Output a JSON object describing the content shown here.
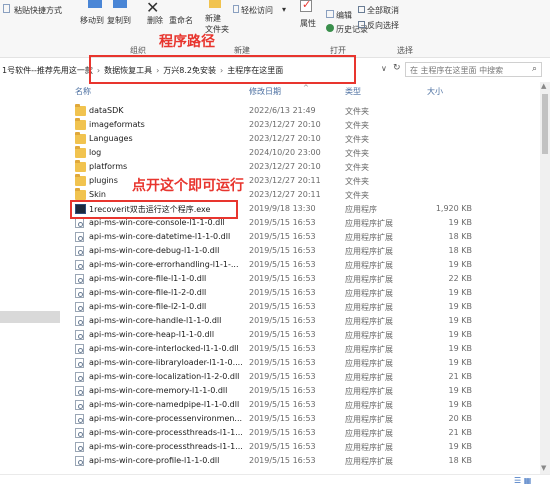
{
  "ribbon": {
    "paste_shortcut": "粘贴快捷方式",
    "move_to": "移动到",
    "copy_to": "复制到",
    "delete": "删除",
    "rename": "重命名",
    "new_folder": "新建\n文件夹",
    "easy_access": "轻松访问",
    "properties": "属性",
    "edit": "编辑",
    "history": "历史记录",
    "select_all": "全部取消",
    "invert_select": "反向选择",
    "group_organize": "组织",
    "group_new": "新建",
    "group_open": "打开",
    "group_select": "选择"
  },
  "address": {
    "crumbs": [
      "1号软件--推荐先用这一款",
      "数据恢复工具",
      "万兴8.2免安装",
      "主程序在这里面"
    ],
    "search_placeholder": "在 主程序在这里面 中搜索"
  },
  "columns": {
    "name": "名称",
    "date": "修改日期",
    "type": "类型",
    "size": "大小"
  },
  "annotations": {
    "path_label": "程序路径",
    "run_label": "点开这个即可运行"
  },
  "files": [
    {
      "name": "dataSDK",
      "date": "2022/6/13 21:49",
      "type": "文件夹",
      "size": "",
      "icon": "folder-icon"
    },
    {
      "name": "imageformats",
      "date": "2023/12/27 20:10",
      "type": "文件夹",
      "size": "",
      "icon": "folder-icon"
    },
    {
      "name": "Languages",
      "date": "2023/12/27 20:10",
      "type": "文件夹",
      "size": "",
      "icon": "folder-icon"
    },
    {
      "name": "log",
      "date": "2024/10/20 23:00",
      "type": "文件夹",
      "size": "",
      "icon": "folder-icon"
    },
    {
      "name": "platforms",
      "date": "2023/12/27 20:10",
      "type": "文件夹",
      "size": "",
      "icon": "folder-icon"
    },
    {
      "name": "plugins",
      "date": "2023/12/27 20:11",
      "type": "文件夹",
      "size": "",
      "icon": "folder-icon"
    },
    {
      "name": "Skin",
      "date": "2023/12/27 20:11",
      "type": "文件夹",
      "size": "",
      "icon": "folder-icon"
    },
    {
      "name": "1recoverit双击运行这个程序.exe",
      "date": "2019/9/18 13:30",
      "type": "应用程序",
      "size": "1,920 KB",
      "icon": "exe-icon"
    },
    {
      "name": "api-ms-win-core-console-l1-1-0.dll",
      "date": "2019/5/15 16:53",
      "type": "应用程序扩展",
      "size": "19 KB",
      "icon": "dll-icon"
    },
    {
      "name": "api-ms-win-core-datetime-l1-1-0.dll",
      "date": "2019/5/15 16:53",
      "type": "应用程序扩展",
      "size": "18 KB",
      "icon": "dll-icon"
    },
    {
      "name": "api-ms-win-core-debug-l1-1-0.dll",
      "date": "2019/5/15 16:53",
      "type": "应用程序扩展",
      "size": "18 KB",
      "icon": "dll-icon"
    },
    {
      "name": "api-ms-win-core-errorhandling-l1-1-...",
      "date": "2019/5/15 16:53",
      "type": "应用程序扩展",
      "size": "19 KB",
      "icon": "dll-icon"
    },
    {
      "name": "api-ms-win-core-file-l1-1-0.dll",
      "date": "2019/5/15 16:53",
      "type": "应用程序扩展",
      "size": "22 KB",
      "icon": "dll-icon"
    },
    {
      "name": "api-ms-win-core-file-l1-2-0.dll",
      "date": "2019/5/15 16:53",
      "type": "应用程序扩展",
      "size": "19 KB",
      "icon": "dll-icon"
    },
    {
      "name": "api-ms-win-core-file-l2-1-0.dll",
      "date": "2019/5/15 16:53",
      "type": "应用程序扩展",
      "size": "19 KB",
      "icon": "dll-icon"
    },
    {
      "name": "api-ms-win-core-handle-l1-1-0.dll",
      "date": "2019/5/15 16:53",
      "type": "应用程序扩展",
      "size": "19 KB",
      "icon": "dll-icon"
    },
    {
      "name": "api-ms-win-core-heap-l1-1-0.dll",
      "date": "2019/5/15 16:53",
      "type": "应用程序扩展",
      "size": "19 KB",
      "icon": "dll-icon"
    },
    {
      "name": "api-ms-win-core-interlocked-l1-1-0.dll",
      "date": "2019/5/15 16:53",
      "type": "应用程序扩展",
      "size": "19 KB",
      "icon": "dll-icon"
    },
    {
      "name": "api-ms-win-core-libraryloader-l1-1-0....",
      "date": "2019/5/15 16:53",
      "type": "应用程序扩展",
      "size": "19 KB",
      "icon": "dll-icon"
    },
    {
      "name": "api-ms-win-core-localization-l1-2-0.dll",
      "date": "2019/5/15 16:53",
      "type": "应用程序扩展",
      "size": "21 KB",
      "icon": "dll-icon"
    },
    {
      "name": "api-ms-win-core-memory-l1-1-0.dll",
      "date": "2019/5/15 16:53",
      "type": "应用程序扩展",
      "size": "19 KB",
      "icon": "dll-icon"
    },
    {
      "name": "api-ms-win-core-namedpipe-l1-1-0.dll",
      "date": "2019/5/15 16:53",
      "type": "应用程序扩展",
      "size": "19 KB",
      "icon": "dll-icon"
    },
    {
      "name": "api-ms-win-core-processenvironmen...",
      "date": "2019/5/15 16:53",
      "type": "应用程序扩展",
      "size": "20 KB",
      "icon": "dll-icon"
    },
    {
      "name": "api-ms-win-core-processthreads-l1-1...",
      "date": "2019/5/15 16:53",
      "type": "应用程序扩展",
      "size": "21 KB",
      "icon": "dll-icon"
    },
    {
      "name": "api-ms-win-core-processthreads-l1-1...",
      "date": "2019/5/15 16:53",
      "type": "应用程序扩展",
      "size": "19 KB",
      "icon": "dll-icon"
    },
    {
      "name": "api-ms-win-core-profile-l1-1-0.dll",
      "date": "2019/5/15 16:53",
      "type": "应用程序扩展",
      "size": "18 KB",
      "icon": "dll-icon"
    }
  ]
}
